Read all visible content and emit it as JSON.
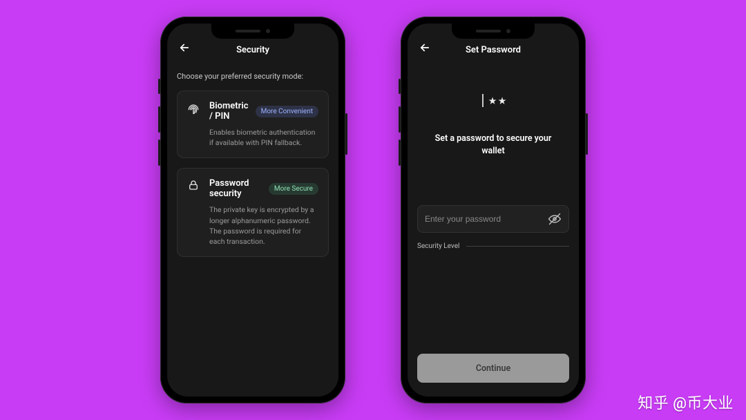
{
  "watermark": "知乎 @币大业",
  "phone1": {
    "title": "Security",
    "subhead": "Choose your preferred security mode:",
    "options": [
      {
        "name": "Biometric / PIN",
        "badge": "More Convenient",
        "badge_kind": "blue",
        "icon": "fingerprint",
        "desc": "Enables biometric authentication if available with PIN fallback."
      },
      {
        "name": "Password security",
        "badge": "More Secure",
        "badge_kind": "green",
        "icon": "lock",
        "desc": "The private key is encrypted by a longer alphanumeric password. The password is required for each transaction."
      }
    ]
  },
  "phone2": {
    "title": "Set Password",
    "mask": "|★★",
    "prompt": "Set a password to secure your wallet",
    "placeholder": "Enter your password",
    "value": "",
    "security_level_label": "Security Level",
    "continue_label": "Continue"
  }
}
